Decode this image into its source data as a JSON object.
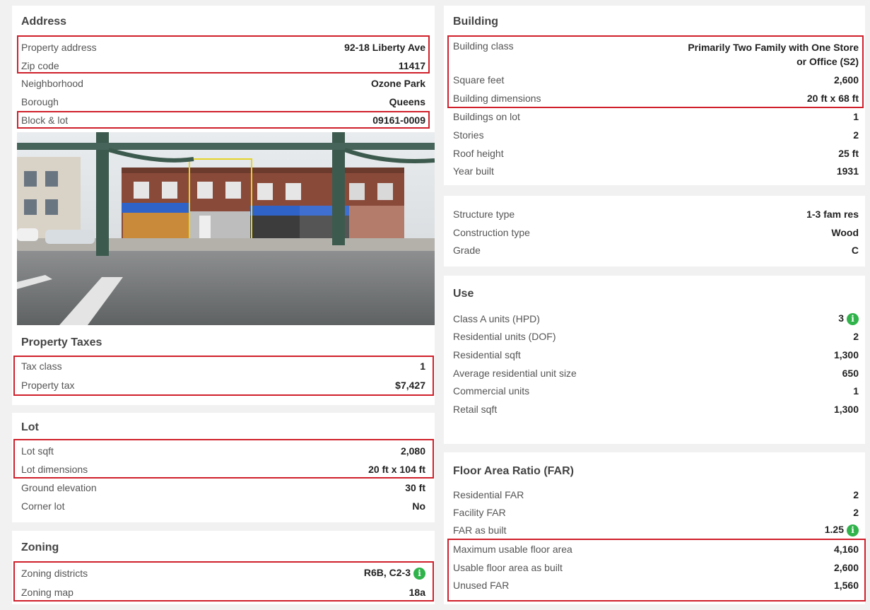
{
  "left": {
    "address": {
      "title": "Address",
      "rows": [
        {
          "label": "Property address",
          "value": "92-18 Liberty Ave"
        },
        {
          "label": "Zip code",
          "value": "11417"
        },
        {
          "label": "Neighborhood",
          "value": "Ozone Park"
        },
        {
          "label": "Borough",
          "value": "Queens"
        },
        {
          "label": "Block & lot",
          "value": "09161-0009"
        }
      ]
    },
    "property_taxes": {
      "title": "Property Taxes",
      "rows": [
        {
          "label": "Tax class",
          "value": "1"
        },
        {
          "label": "Property tax",
          "value": "$7,427"
        }
      ]
    },
    "lot": {
      "title": "Lot",
      "rows": [
        {
          "label": "Lot sqft",
          "value": "2,080"
        },
        {
          "label": "Lot dimensions",
          "value": "20 ft x 104 ft"
        },
        {
          "label": "Ground elevation",
          "value": "30 ft"
        },
        {
          "label": "Corner lot",
          "value": "No"
        }
      ]
    },
    "zoning": {
      "title": "Zoning",
      "rows": [
        {
          "label": "Zoning districts",
          "value": "R6B, C2-3"
        },
        {
          "label": "Zoning map",
          "value": "18a"
        }
      ]
    }
  },
  "right": {
    "building": {
      "title": "Building",
      "rows": [
        {
          "label": "Building class",
          "value_line1": "Primarily Two Family with One Store",
          "value_line2": "or Office (S2)"
        },
        {
          "label": "Square feet",
          "value": "2,600"
        },
        {
          "label": "Building dimensions",
          "value": "20 ft x 68 ft"
        },
        {
          "label": "Buildings on lot",
          "value": "1"
        },
        {
          "label": "Stories",
          "value": "2"
        },
        {
          "label": "Roof height",
          "value": "25 ft"
        },
        {
          "label": "Year built",
          "value": "1931"
        }
      ]
    },
    "structure": {
      "rows": [
        {
          "label": "Structure type",
          "value": "1-3 fam res"
        },
        {
          "label": "Construction type",
          "value": "Wood"
        },
        {
          "label": "Grade",
          "value": "C"
        }
      ]
    },
    "use": {
      "title": "Use",
      "rows": [
        {
          "label": "Class A units (HPD)",
          "value": "3"
        },
        {
          "label": "Residential units (DOF)",
          "value": "2"
        },
        {
          "label": "Residential sqft",
          "value": "1,300"
        },
        {
          "label": "Average residential unit size",
          "value": "650"
        },
        {
          "label": "Commercial units",
          "value": "1"
        },
        {
          "label": "Retail sqft",
          "value": "1,300"
        }
      ]
    },
    "far": {
      "title": "Floor Area Ratio (FAR)",
      "rows": [
        {
          "label": "Residential FAR",
          "value": "2"
        },
        {
          "label": "Facility FAR",
          "value": "2"
        },
        {
          "label": "FAR as built",
          "value": "1.25"
        },
        {
          "label": "Maximum usable floor area",
          "value": "4,160"
        },
        {
          "label": "Usable floor area as built",
          "value": "2,600"
        },
        {
          "label": "Unused FAR",
          "value": "1,560"
        }
      ]
    }
  },
  "icons": {
    "info": "info-icon",
    "info_glyph": "i"
  },
  "colors": {
    "highlight": "#d0202b",
    "info": "#2fb34a",
    "link": "#1a7fc4"
  }
}
